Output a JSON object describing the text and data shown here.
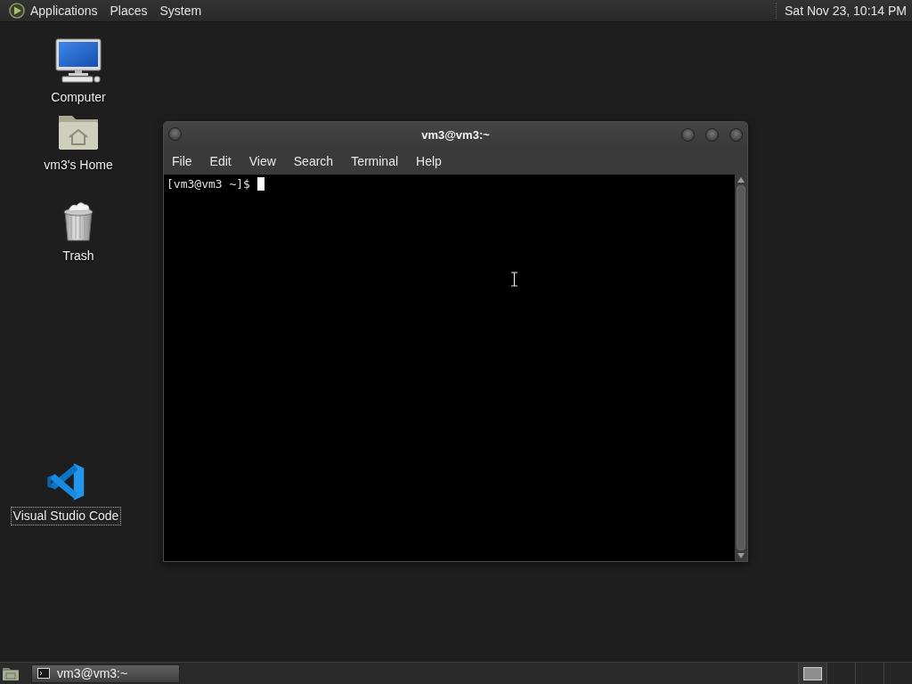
{
  "top_panel": {
    "menus": [
      "Applications",
      "Places",
      "System"
    ],
    "clock": "Sat Nov 23, 10:14 PM"
  },
  "desktop": {
    "icons": [
      {
        "kind": "computer",
        "label": "Computer",
        "selected": false
      },
      {
        "kind": "home",
        "label": "vm3's Home",
        "selected": false
      },
      {
        "kind": "trash",
        "label": "Trash",
        "selected": false
      },
      {
        "kind": "vscode",
        "label": "Visual Studio Code",
        "selected": true
      }
    ]
  },
  "terminal_window": {
    "title": "vm3@vm3:~",
    "menu": [
      "File",
      "Edit",
      "View",
      "Search",
      "Terminal",
      "Help"
    ],
    "prompt": "[vm3@vm3 ~]$"
  },
  "bottom_panel": {
    "tasks": [
      {
        "label": "vm3@vm3:~",
        "selected": true
      }
    ],
    "workspaces": [
      {
        "selected": true
      },
      {
        "selected": false
      },
      {
        "selected": false
      },
      {
        "selected": false
      }
    ]
  }
}
